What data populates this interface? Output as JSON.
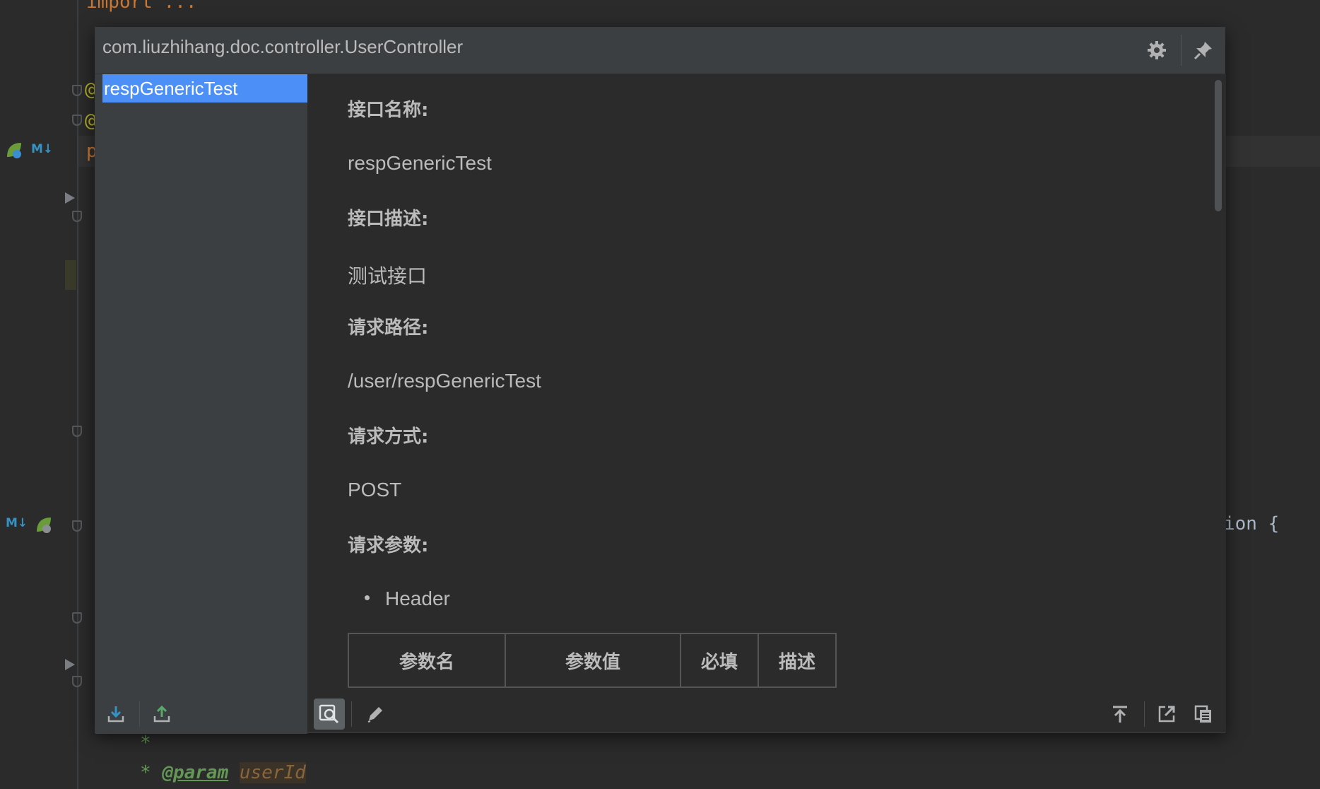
{
  "editor": {
    "code_top": "import ...",
    "code_doc_star": "*",
    "code_doc_param_star": "* ",
    "code_doc_param_tag": "@param",
    "code_doc_param_var": "userId",
    "code_right_fragment": "ion {",
    "code_annotation_1": "@",
    "code_annotation_2": "@",
    "code_p": "p",
    "md_badge": "M↓"
  },
  "popup": {
    "title": "com.liuzhihang.doc.controller.UserController",
    "methods": [
      "respGenericTest"
    ],
    "sections": [
      {
        "label": "接口名称:",
        "value": "respGenericTest"
      },
      {
        "label": "接口描述:",
        "value": "测试接口"
      },
      {
        "label": "请求路径:",
        "value": "/user/respGenericTest"
      },
      {
        "label": "请求方式:",
        "value": "POST"
      },
      {
        "label": "请求参数:"
      }
    ],
    "param_groups": [
      "Header"
    ],
    "table_headers": [
      "参数名",
      "参数值",
      "必填",
      "描述"
    ]
  },
  "icons": {
    "settings": "gear-icon",
    "pin": "pin-icon",
    "export": "download-icon",
    "import": "upload-icon",
    "search": "search-icon",
    "edit": "pencil-icon",
    "scroll_top": "scroll-to-top-icon",
    "open_external": "open-in-window-icon",
    "copy": "copy-icon"
  },
  "colors": {
    "accent": "#4b8ff7",
    "background": "#2b2b2b",
    "panel": "#3c3f41",
    "text": "#bbbbbb"
  }
}
